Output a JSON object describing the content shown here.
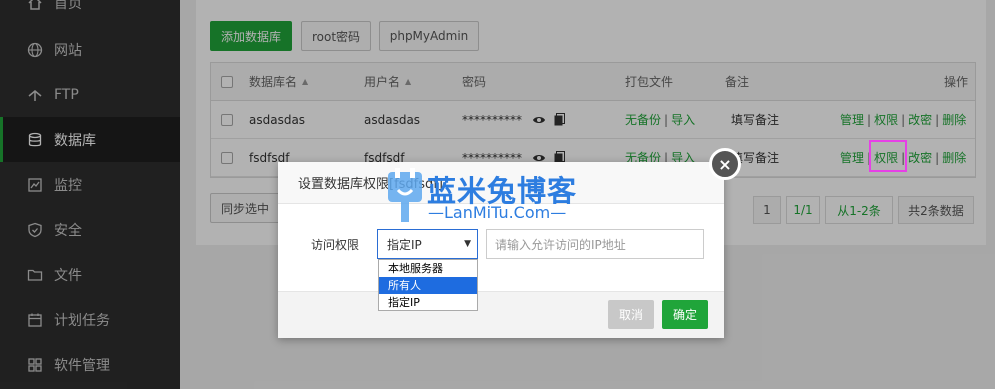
{
  "sidebar": {
    "items": [
      {
        "label": "首页",
        "icon": "home-icon"
      },
      {
        "label": "网站",
        "icon": "globe-icon"
      },
      {
        "label": "FTP",
        "icon": "ftp-icon"
      },
      {
        "label": "数据库",
        "icon": "database-icon",
        "active": true
      },
      {
        "label": "监控",
        "icon": "monitor-icon"
      },
      {
        "label": "安全",
        "icon": "shield-icon"
      },
      {
        "label": "文件",
        "icon": "folder-icon"
      },
      {
        "label": "计划任务",
        "icon": "calendar-icon"
      },
      {
        "label": "软件管理",
        "icon": "apps-icon"
      }
    ]
  },
  "toolbar": {
    "add_db": "添加数据库",
    "root_pwd": "root密码",
    "phpmyadmin": "phpMyAdmin"
  },
  "table": {
    "headers": {
      "name": "数据库名",
      "user": "用户名",
      "password": "密码",
      "backup": "打包文件",
      "note": "备注",
      "ops": "操作"
    },
    "rows": [
      {
        "name": "asdasdas",
        "user": "asdasdas",
        "password": "**********",
        "backup_none": "无备份",
        "import": "导入",
        "note": "填写备注",
        "manage": "管理",
        "perm": "权限",
        "chpwd": "改密",
        "delete": "删除"
      },
      {
        "name": "fsdfsdf",
        "user": "fsdfsdf",
        "password": "**********",
        "backup_none": "无备份",
        "import": "导入",
        "note": "填写备注",
        "manage": "管理",
        "perm": "权限",
        "chpwd": "改密",
        "delete": "删除"
      }
    ],
    "separator": "|"
  },
  "footer": {
    "sync": "同步选中",
    "pager": {
      "page": "1",
      "current": "1/1",
      "range": "从1-2条",
      "total": "共2条数据"
    }
  },
  "modal": {
    "title": "设置数据库权限[fsdfsdf]",
    "label": "访问权限",
    "selected": "指定IP",
    "options": [
      "本地服务器",
      "所有人",
      "指定IP"
    ],
    "highlighted_option": 1,
    "ip_placeholder": "请输入允许访问的IP地址",
    "cancel": "取消",
    "confirm": "确定",
    "close": "×"
  },
  "watermark": {
    "title": "蓝米兔博客",
    "subtitle": "—LanMiTu.Com—"
  },
  "colors": {
    "brand_green": "#20a53a",
    "sidebar_bg": "#2f2f2f",
    "highlight_magenta": "#e640e6",
    "watermark_blue": "#2d7de0"
  }
}
